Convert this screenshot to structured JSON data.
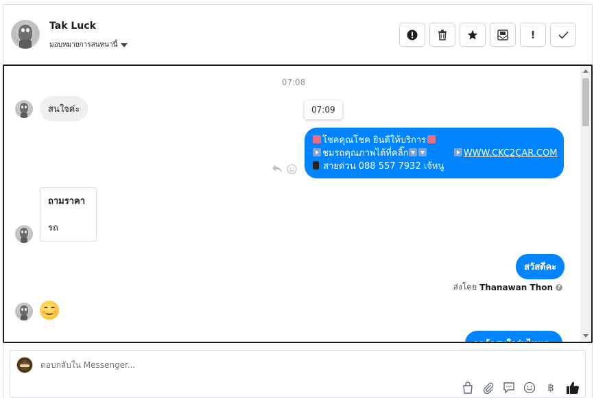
{
  "header": {
    "contact_name": "Tak Luck",
    "assign_label": "มอบหมายการสนทนานี้",
    "toolbar": [
      {
        "name": "spam-button",
        "glyph": "❗"
      },
      {
        "name": "delete-button",
        "glyph": "🗑"
      },
      {
        "name": "star-button",
        "glyph": "★"
      },
      {
        "name": "archive-button",
        "glyph": "✉"
      },
      {
        "name": "follow-up-button",
        "glyph": "!"
      },
      {
        "name": "mark-done-button",
        "glyph": "✓"
      }
    ]
  },
  "chat": {
    "time_separator": "07:08",
    "tooltip_time": "07:09",
    "incoming_1": "สนใจค่ะ",
    "promo": {
      "line1": "โชคคุณโชค ยินดีให้บริการ",
      "line2": "ชมรถคุณภาพได้ที่คลิ๊ก",
      "link": "WWW.CKC2CAR.COM",
      "line3": "สายด่วน 088 557 7932 เจ้หนู"
    },
    "card": {
      "title": "ถามราคา",
      "body": "รถ"
    },
    "outgoing_greeting": "สวัสดีคะ",
    "sent_by_prefix": "ส่งโดย",
    "sent_by_name": "Thanawan Thon",
    "outgoing_partial": "ลูกค้าสนใจรุ่นไหนคะ"
  },
  "composer": {
    "placeholder": "ตอบกลับใน Messenger..."
  },
  "colors": {
    "outgoing_bubble": "#0084ff",
    "incoming_bubble": "#f1f0f0",
    "like_icon": "#1c1e21"
  }
}
